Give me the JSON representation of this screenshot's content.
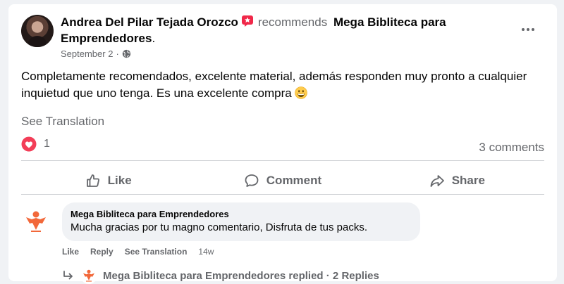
{
  "post": {
    "author": "Andrea Del Pilar Tejada Orozco",
    "recommends_word": "recommends",
    "page_name": "Mega Bibliteca para Emprendedores",
    "page_suffix": ".",
    "date": "September 2",
    "date_separator": "·",
    "body": "Completamente recomendados, excelente material, además responden muy pronto a cualquier inquietud que uno tenga. Es una excelente compra",
    "see_translation": "See Translation",
    "reaction_count": "1",
    "comments_count": "3 comments",
    "icons": {
      "more": "more-options-icon",
      "recommend_badge": "recommend-badge-icon",
      "globe": "globe-icon",
      "emoji": "grinning-face-emoji",
      "reaction": "love-reaction-icon"
    }
  },
  "actions": {
    "like": "Like",
    "comment": "Comment",
    "share": "Share"
  },
  "comment": {
    "author": "Mega Bibliteca para Emprendedores",
    "text": "Mucha gracias por tu magno comentario, Disfruta de tus packs.",
    "like": "Like",
    "reply": "Reply",
    "see_translation": "See Translation",
    "time": "14w",
    "replies_text": "Mega Bibliteca para Emprendedores replied · 2 Replies"
  },
  "colors": {
    "background": "#f0f2f5",
    "card": "#ffffff",
    "secondary_text": "#65676b",
    "love_red": "#f33e58",
    "badge_pink": "#f02849",
    "logo_orange": "#f2683a"
  }
}
